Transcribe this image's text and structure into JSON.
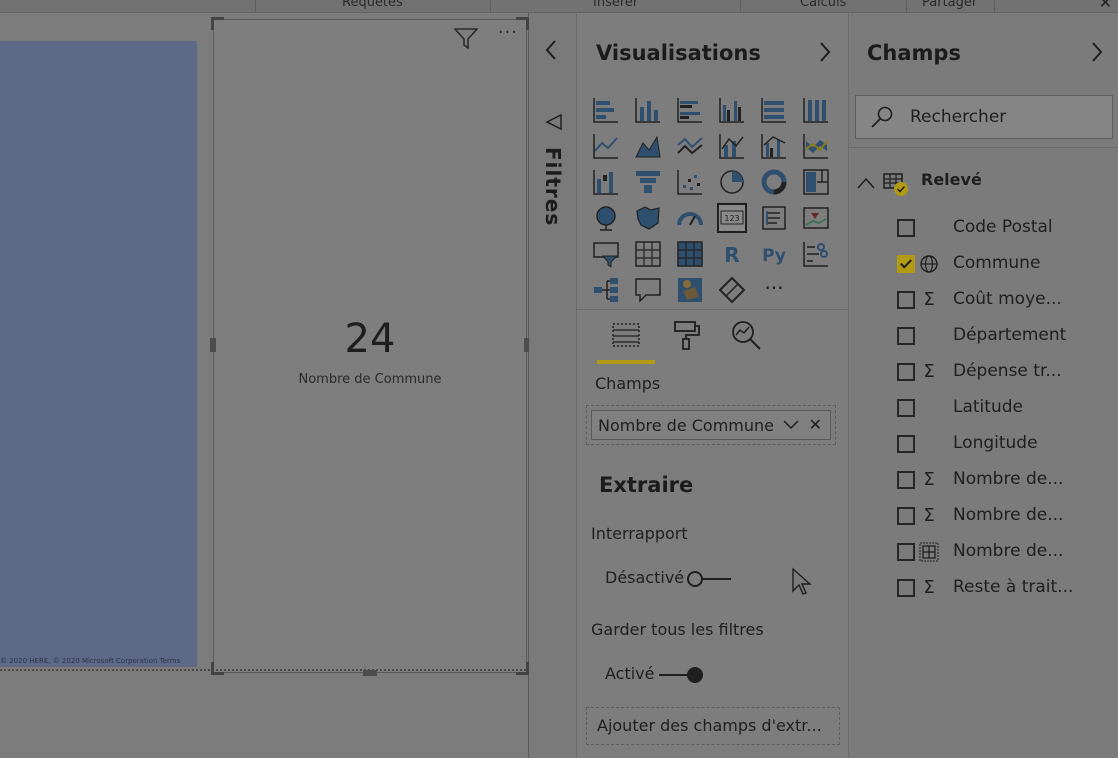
{
  "ribbon": {
    "groups": [
      "Requêtes",
      "Insérer",
      "Calculs",
      "Partager"
    ],
    "close_glyph": "✕"
  },
  "canvas": {
    "map_credit": "© 2020 HERE, © 2020 Microsoft Corporation  Terms",
    "card": {
      "value": "24",
      "label": "Nombre de Commune",
      "more_glyph": "···"
    }
  },
  "filters": {
    "label": "Filtres"
  },
  "visualisations": {
    "title": "Visualisations",
    "more_glyph": "···",
    "icons": [
      "stacked-bar-icon",
      "stacked-column-icon",
      "clustered-bar-icon",
      "clustered-column-icon",
      "percent-bar-icon",
      "percent-column-icon",
      "line-chart-icon",
      "area-chart-icon",
      "stacked-area-icon",
      "line-column-icon",
      "line-clustered-column-icon",
      "ribbon-chart-icon",
      "waterfall-icon",
      "funnel-icon",
      "scatter-icon",
      "pie-icon",
      "donut-icon",
      "treemap-icon",
      "map-icon",
      "filled-map-icon",
      "gauge-icon",
      "card-icon",
      "multirow-card-icon",
      "kpi-icon",
      "slicer-icon",
      "table-icon",
      "matrix-icon",
      "r-visual-icon",
      "python-visual-icon",
      "key-influencers-icon",
      "decomposition-tree-icon",
      "qa-icon",
      "shape-map-icon",
      "power-apps-icon",
      "more-visuals-icon"
    ],
    "fields_section": "Champs",
    "field_well_value": "Nombre de Commune",
    "drillthrough_title": "Extraire",
    "cross_report_label": "Interrapport",
    "cross_report_state": "Désactivé",
    "keep_filters_label": "Garder tous les filtres",
    "keep_filters_state": "Activé",
    "add_drill_fields": "Ajouter des champs d'extr..."
  },
  "fields_pane": {
    "title": "Champs",
    "search_placeholder": "Rechercher",
    "table_name": "Relevé",
    "items": [
      {
        "name": "Code Postal",
        "icon": "",
        "checked": false
      },
      {
        "name": "Commune",
        "icon": "globe",
        "checked": true
      },
      {
        "name": "Coût moye...",
        "icon": "sigma",
        "checked": false
      },
      {
        "name": "Département",
        "icon": "",
        "checked": false
      },
      {
        "name": "Dépense tr...",
        "icon": "sigma",
        "checked": false
      },
      {
        "name": "Latitude",
        "icon": "",
        "checked": false
      },
      {
        "name": "Longitude",
        "icon": "",
        "checked": false
      },
      {
        "name": "Nombre de...",
        "icon": "sigma",
        "checked": false
      },
      {
        "name": "Nombre de...",
        "icon": "sigma",
        "checked": false
      },
      {
        "name": "Nombre de...",
        "icon": "table",
        "checked": false
      },
      {
        "name": "Reste à trait...",
        "icon": "sigma",
        "checked": false
      }
    ]
  },
  "colors": {
    "accent": "#b39a14",
    "map_fill": "#5c6a87",
    "overlay_bg": "#7b7b7b"
  }
}
